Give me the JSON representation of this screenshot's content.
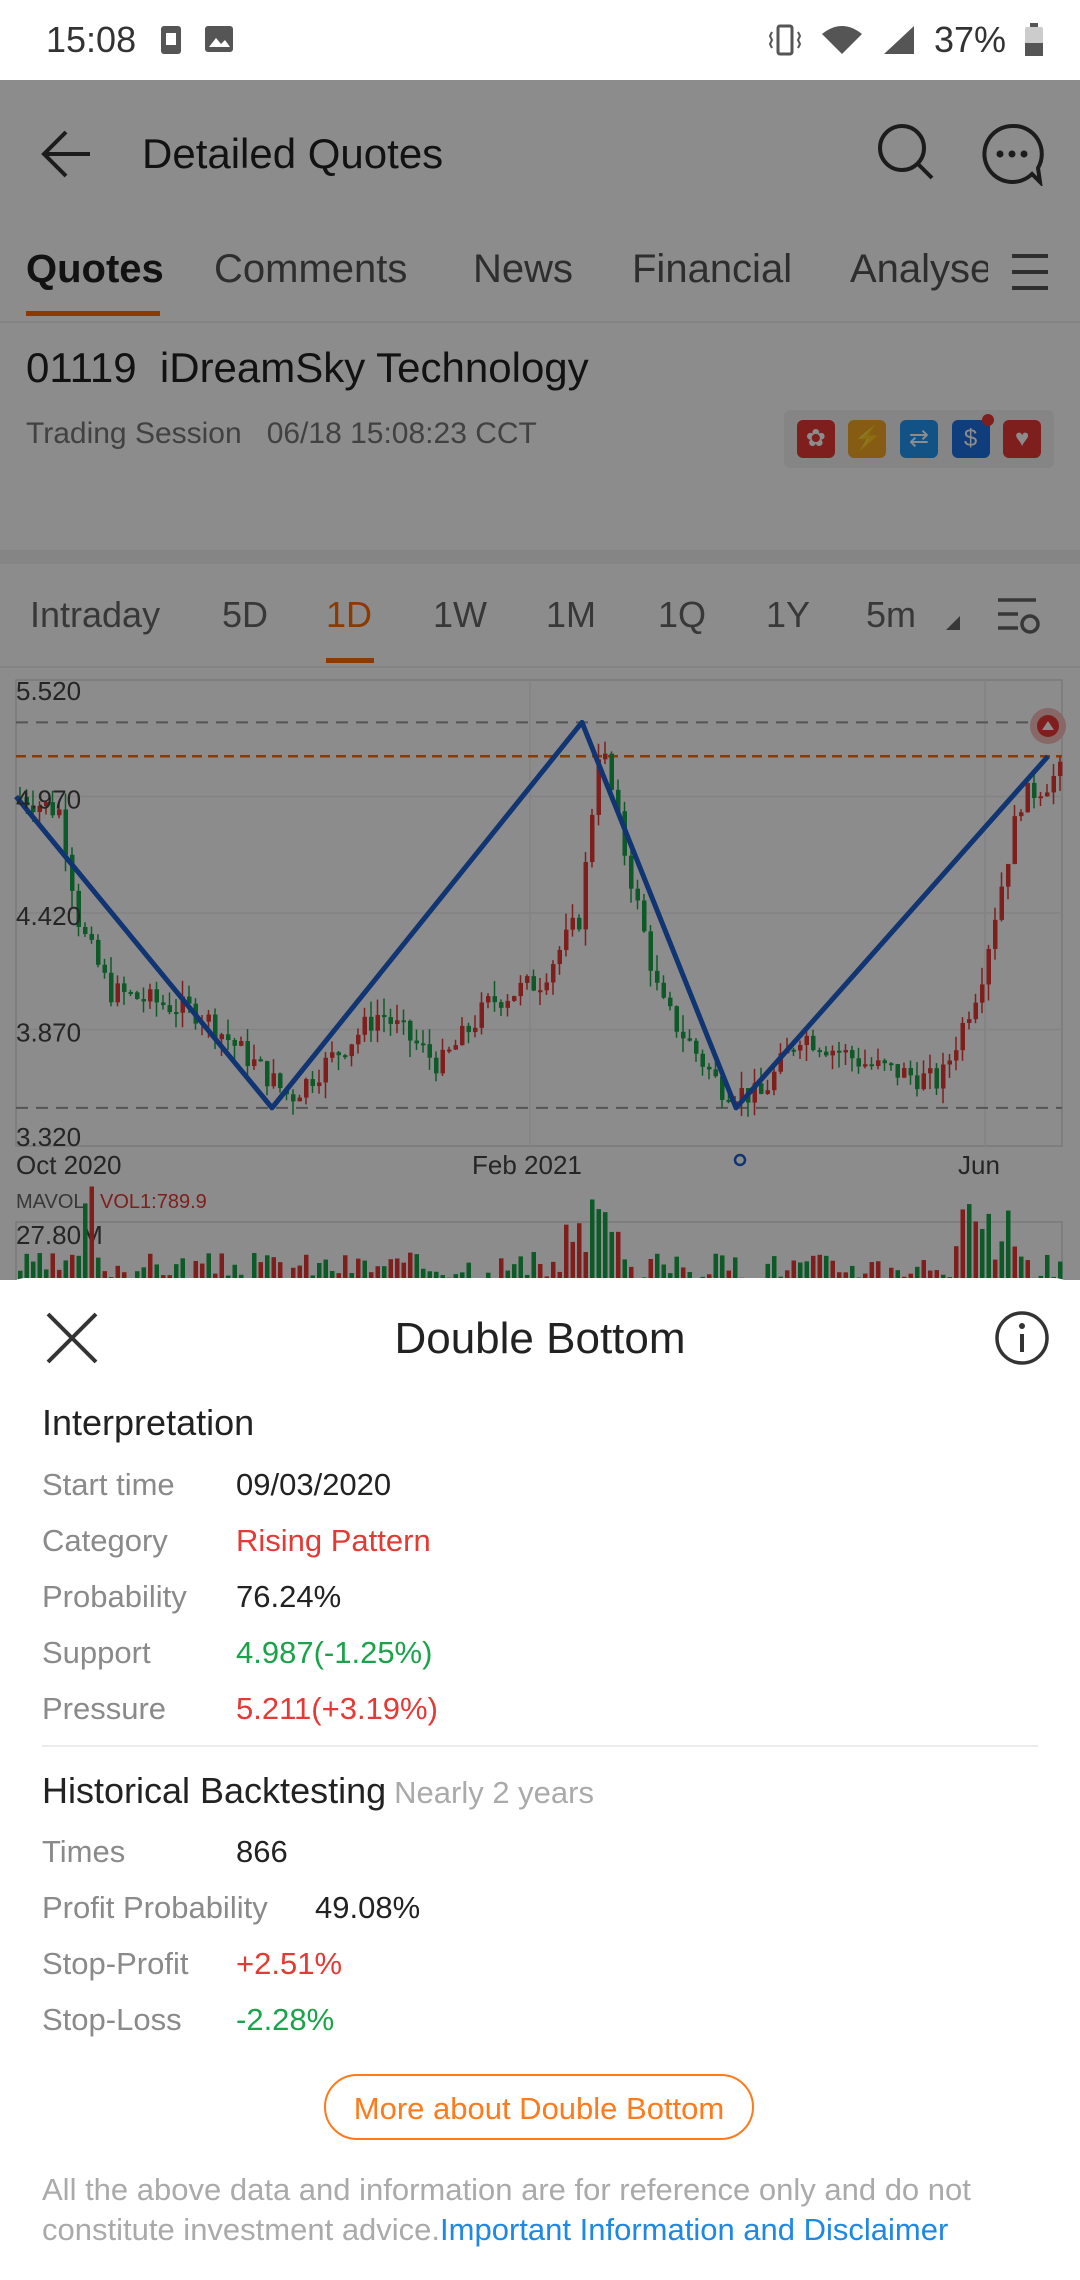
{
  "status_bar": {
    "time": "15:08",
    "battery": "37%"
  },
  "header": {
    "title": "Detailed Quotes"
  },
  "tabs": [
    {
      "label": "Quotes"
    },
    {
      "label": "Comments"
    },
    {
      "label": "News"
    },
    {
      "label": "Financial"
    },
    {
      "label": "Analyse"
    }
  ],
  "stock": {
    "code": "01119",
    "name": "iDreamSky Technology",
    "session_label": "Trading Session",
    "session_time": "06/18 15:08:23 CCT"
  },
  "periods": [
    {
      "label": "Intraday"
    },
    {
      "label": "5D"
    },
    {
      "label": "1D"
    },
    {
      "label": "1W"
    },
    {
      "label": "1M"
    },
    {
      "label": "1Q"
    },
    {
      "label": "1Y"
    },
    {
      "label": "5m"
    }
  ],
  "chart_data": {
    "type": "line",
    "title": "",
    "y_ticks": [
      "5.520",
      "4.970",
      "4.420",
      "3.870",
      "3.320"
    ],
    "x_ticks": [
      "Oct 2020",
      "Feb 2021",
      "Jun"
    ],
    "pattern_line": {
      "name": "Double Bottom",
      "points": [
        {
          "x": "Sep 2020",
          "y": 4.97
        },
        {
          "x": "Nov 2020",
          "y": 3.5
        },
        {
          "x": "Feb 2021",
          "y": 5.32
        },
        {
          "x": "Apr 2021",
          "y": 3.5
        },
        {
          "x": "Jun 2021",
          "y": 5.16
        }
      ]
    },
    "volume_label": "MAVOL",
    "volume_value": "VOL1:789.9",
    "volume_max": "27.80M"
  },
  "sheet": {
    "title": "Double Bottom",
    "interpretation_title": "Interpretation",
    "rows": [
      {
        "label": "Start time",
        "value": "09/03/2020"
      },
      {
        "label": "Category",
        "value": "Rising Pattern"
      },
      {
        "label": "Probability",
        "value": "76.24%"
      },
      {
        "label": "Support",
        "value": "4.987(-1.25%)"
      },
      {
        "label": "Pressure",
        "value": "5.211(+3.19%)"
      }
    ],
    "backtest_title": "Historical Backtesting",
    "backtest_sub": "Nearly 2 years",
    "backtest_rows": [
      {
        "label": "Times",
        "value": "866"
      },
      {
        "label": "Profit Probability",
        "value": "49.08%"
      },
      {
        "label": "Stop-Profit",
        "value": "+2.51%"
      },
      {
        "label": "Stop-Loss",
        "value": "-2.28%"
      }
    ],
    "more_button": "More about Double Bottom",
    "disclaimer": "All the above data and information are for reference only and do not constitute investment advice.",
    "disclaimer_link": "Important Information and Disclaimer"
  },
  "colors": {
    "accent": "#ff6a00",
    "up": "#e53935",
    "down": "#1aa34a",
    "pattern": "#1f5fd1"
  }
}
